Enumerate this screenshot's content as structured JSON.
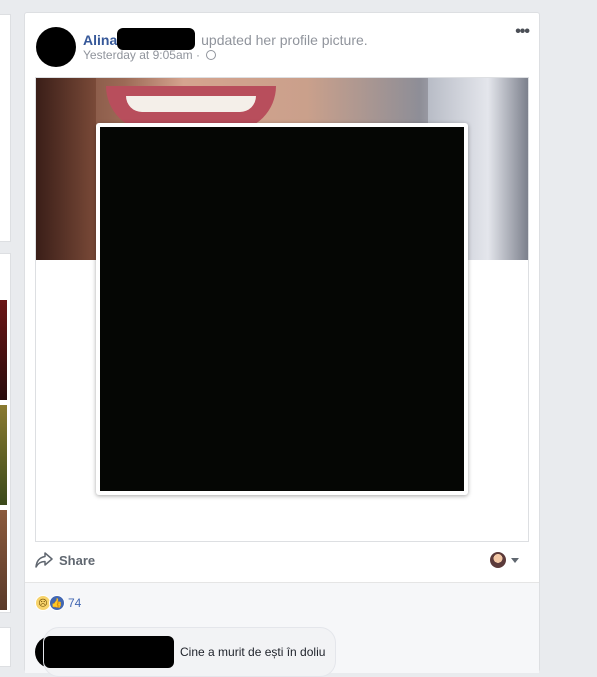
{
  "post": {
    "author_first": "Alina",
    "action": " updated her profile picture.",
    "timestamp": "Yesterday at 9:05am",
    "separator": " · ",
    "more_icon": "•••"
  },
  "actions": {
    "share_label": "Share"
  },
  "reactions": {
    "count": "74",
    "types": [
      "sad",
      "like"
    ]
  },
  "comment": {
    "text": "Cine a murit de ești în doliu"
  },
  "colors": {
    "link": "#365899",
    "meta": "#90949c",
    "like_blue": "#4267b2",
    "footer_bg": "#f6f7f9"
  }
}
